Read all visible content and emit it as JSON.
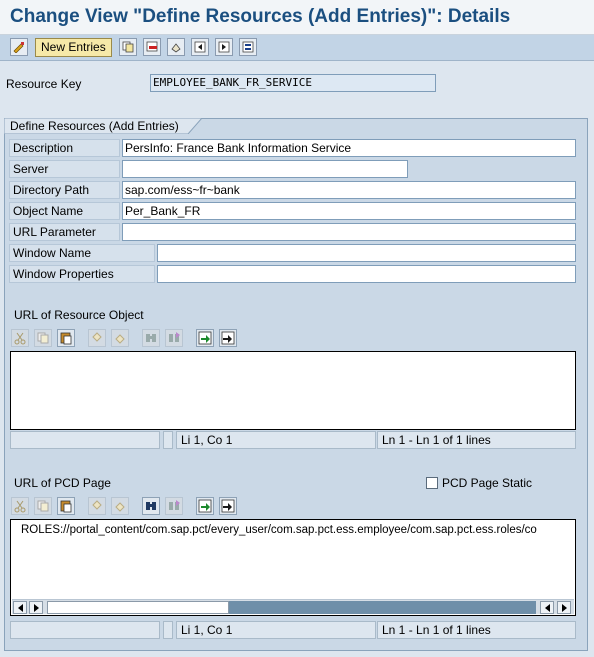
{
  "title": "Change View \"Define Resources (Add Entries)\": Details",
  "toolbar": {
    "new_entries_label": "New Entries",
    "icons": [
      "display-change-icon",
      "copy-icon",
      "delete-icon",
      "undo-icon",
      "previous-entry-icon",
      "next-entry-icon",
      "select-all-icon"
    ]
  },
  "resource_key": {
    "label": "Resource Key",
    "value": "EMPLOYEE_BANK_FR_SERVICE"
  },
  "group": {
    "title": "Define Resources (Add Entries)",
    "fields": [
      {
        "label": "Description",
        "value": "PersInfo: France Bank Information Service"
      },
      {
        "label": "Server",
        "value": ""
      },
      {
        "label": "Directory Path",
        "value": "sap.com/ess~fr~bank"
      },
      {
        "label": "Object Name",
        "value": "Per_Bank_FR"
      },
      {
        "label": "URL Parameter",
        "value": ""
      },
      {
        "label": "Window Name",
        "value": ""
      },
      {
        "label": "Window Properties",
        "value": ""
      }
    ]
  },
  "url_resource": {
    "label": "URL of Resource Object",
    "text": "",
    "status": {
      "cell1": "",
      "position": "Li 1, Co 1",
      "lines": "Ln 1 - Ln 1 of 1 lines"
    }
  },
  "url_pcd": {
    "label": "URL of PCD Page",
    "checkbox_label": "PCD Page Static",
    "checkbox_checked": false,
    "text": "ROLES://portal_content/com.sap.pct/every_user/com.sap.pct.ess.employee/com.sap.pct.ess.roles/co",
    "status": {
      "cell1": "",
      "position": "Li 1, Co 1",
      "lines": "Ln 1 - Ln 1 of 1 lines"
    }
  },
  "editor_toolbar_icons": [
    "cut-icon",
    "copy-icon",
    "paste-icon",
    "undo-icon",
    "redo-icon",
    "find-icon",
    "find-next-icon",
    "import-icon",
    "export-icon"
  ],
  "colors": {
    "title": "#1b4f80",
    "toolbar": "#c2d4e6",
    "group_bg": "#cad8e6",
    "new_entries_btn": "#f6e9a8"
  }
}
